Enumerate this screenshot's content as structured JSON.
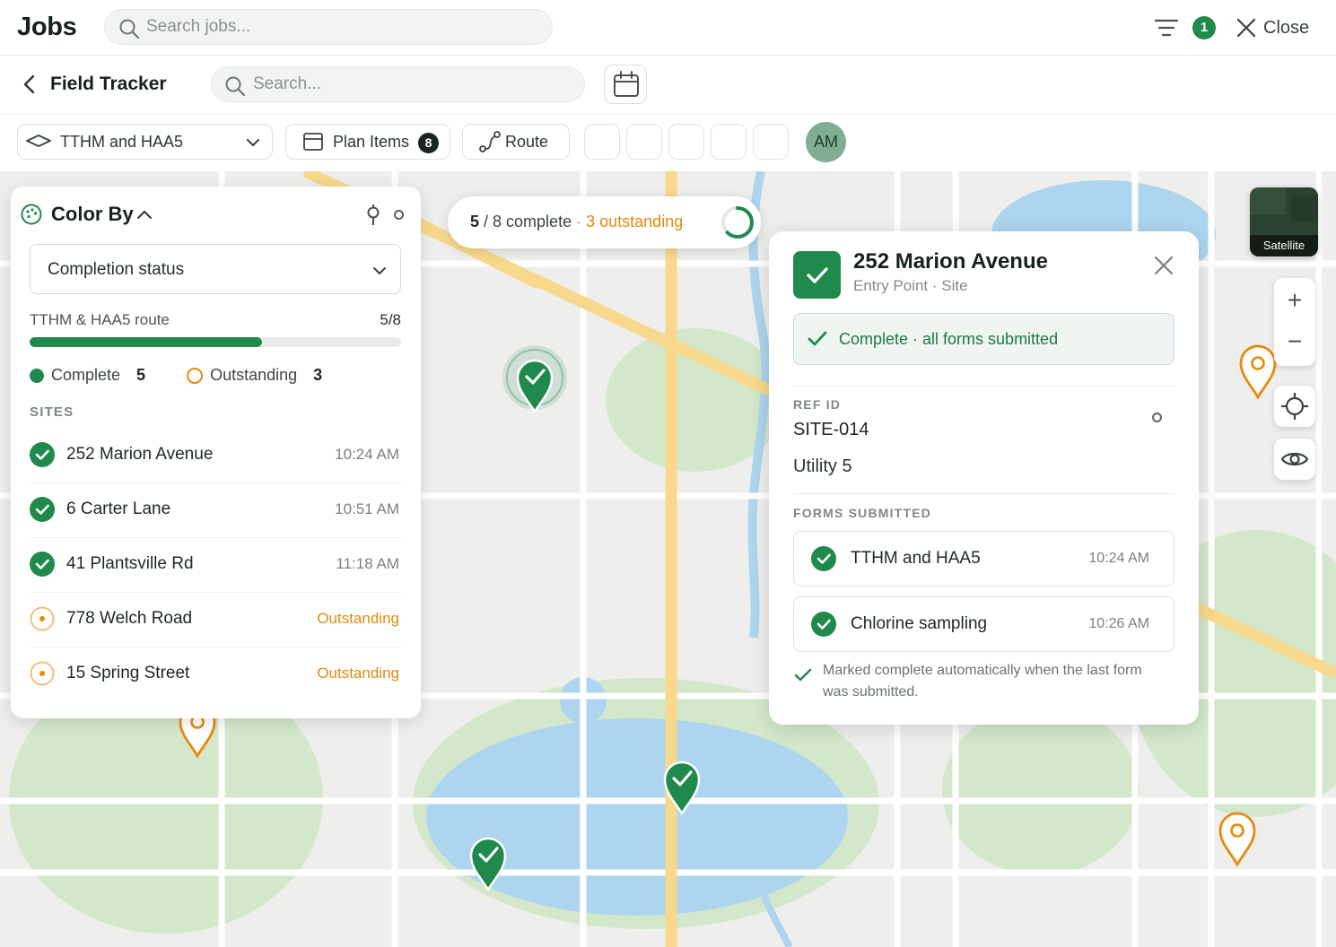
{
  "header": {
    "app_title": "Jobs",
    "search_placeholder": "Search jobs...",
    "filter_count": "1",
    "close_label": "Close"
  },
  "subheader": {
    "title": "Field Tracker",
    "search_placeholder": "Search..."
  },
  "toolbar": {
    "layer_label": "TTHM and HAA5",
    "plan_items_label": "Plan Items",
    "plan_items_count": "8",
    "route_label": "Route",
    "avatar_initials": "AM"
  },
  "panel": {
    "title": "Color By",
    "color_by_value": "Completion status",
    "route_name": "TTHM & HAA5 route",
    "route_progress": "5/8",
    "progress_fraction": 0.625,
    "legend": {
      "complete_label": "Complete",
      "complete_count": "5",
      "outstanding_label": "Outstanding",
      "outstanding_count": "3"
    },
    "sites_heading": "SITES",
    "sites": [
      {
        "name": "252 Marion Avenue",
        "status": "complete",
        "time": "10:24 AM"
      },
      {
        "name": "6 Carter Lane",
        "status": "complete",
        "time": "10:51 AM"
      },
      {
        "name": "41 Plantsville Rd",
        "status": "complete",
        "time": "11:18 AM"
      },
      {
        "name": "778 Welch Road",
        "status": "outstanding",
        "time": "Outstanding"
      },
      {
        "name": "15 Spring Street",
        "status": "outstanding",
        "time": "Outstanding"
      }
    ]
  },
  "summary": {
    "complete_count": "5",
    "total_text": "/ 8 complete",
    "separator": "·",
    "outstanding_text": "3 outstanding",
    "progress_fraction": 0.625
  },
  "detail": {
    "title": "252 Marion Avenue",
    "subtitle": "Entry Point · Site",
    "status_banner": "Complete · all forms submitted",
    "ref_heading": "REF ID",
    "ref_value": "SITE-014",
    "utility": "Utility 5",
    "forms_heading": "FORMS SUBMITTED",
    "forms": [
      {
        "name": "TTHM and HAA5",
        "time": "10:24 AM"
      },
      {
        "name": "Chlorine sampling",
        "time": "10:26 AM"
      }
    ],
    "note": "Marked complete automatically when the last form was submitted."
  },
  "map_controls": {
    "satellite_label": "Satellite",
    "zoom_in": "+",
    "zoom_out": "−"
  },
  "colors": {
    "complete": "#1f8a4c",
    "outstanding": "#e8890c",
    "water": "#a9d3ee",
    "park": "#cfe6c6",
    "major_road": "#f7d88c"
  },
  "icons": {
    "search": "search-icon",
    "filter": "filter-icon",
    "close": "close-icon",
    "back": "chevron-left-icon",
    "calendar": "calendar-icon",
    "layers": "layers-icon",
    "plan": "plan-icon",
    "route": "route-icon",
    "palette": "palette-icon",
    "locate": "crosshair-icon",
    "eye": "eye-icon",
    "check": "check-icon"
  }
}
